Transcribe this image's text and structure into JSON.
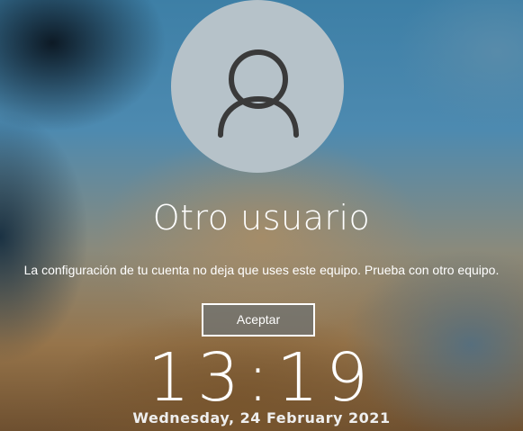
{
  "login": {
    "user_name": "Otro usuario",
    "message": "La configuración de tu cuenta no deja que uses este equipo. Prueba con otro equipo.",
    "accept_label": "Aceptar"
  },
  "lockscreen": {
    "time": "13:19",
    "date": "Wednesday, 24 February 2021"
  },
  "icons": {
    "avatar": "user-silhouette-icon"
  },
  "colors": {
    "avatar_bg": "#b6c2c9",
    "avatar_glyph": "#3a3a3a",
    "button_bg": "#737370",
    "text": "#ffffff"
  }
}
